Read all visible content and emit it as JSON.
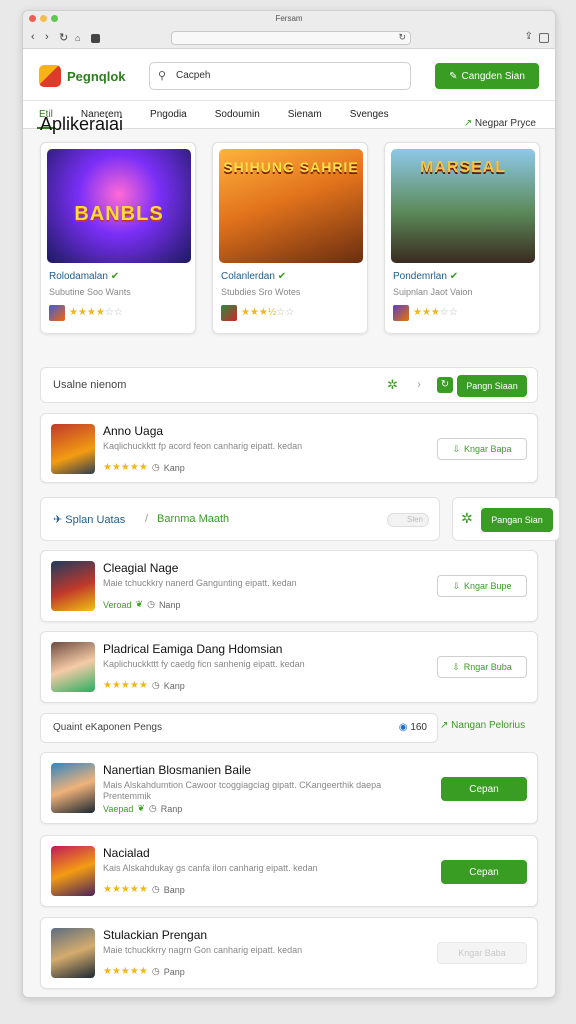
{
  "window": {
    "title": "Fersam"
  },
  "header": {
    "logo_text": "Pegnqlok",
    "search_placeholder": "Cacpeh",
    "cta_label": "Cangden Sian"
  },
  "tabs": [
    "Etil",
    "Nanerem",
    "Pngodia",
    "Sodoumin",
    "Sienam",
    "Svenges"
  ],
  "featured": {
    "title": "Aplikeraiai",
    "link_label": "Negpar Pryce",
    "cards": [
      {
        "art_label": "BANBLS",
        "name": "Rolodamalan",
        "sub": "Subutine Soo Wants",
        "rating": 4
      },
      {
        "art_label": "SHIHUNG SAHRIE",
        "name": "Colanlerdan",
        "sub": "Stubdies Sro Wotes",
        "rating": 3.5
      },
      {
        "art_label": "MARSEAL",
        "name": "Pondemrlan",
        "sub": "Suipnlan Jaot Vaion",
        "rating": 3
      }
    ]
  },
  "filter_bar": {
    "text": "Usalne nienom",
    "button_label": "Pangn Siaan"
  },
  "apps": [
    {
      "title": "Anno Uaga",
      "desc": "Kaqlichuckktt fp acord feon canharig eipatt. kedan",
      "rating": 5,
      "tag": "Kanp",
      "action": "Kngar Bapa"
    },
    {
      "title": "Cleagial Nage",
      "desc": "Maie tchuckkry nanerd Gangunting eipatt. kedan",
      "verified": "Veroad",
      "tag": "Nanp",
      "action": "Kngar Bupe"
    },
    {
      "title": "Pladrical Eamiga Dang Hdomsian",
      "desc": "Kaplichuckkttt fy caedg ficn sanhenig eipatt. kedan",
      "rating": 5,
      "tag": "Kanp",
      "action": "Rngar Buba"
    },
    {
      "title": "Nanertian Blosmanien Baile",
      "desc": "Mais Alskahdumtion Cawoor tcoggiagciag gipatt. CKangeerthik daepa Prentemmik",
      "verified": "Vaepad",
      "tag": "Ranp",
      "action": "Cepan"
    },
    {
      "title": "Nacialad",
      "desc": "Kais Alskahdukay gs canfa ilon canharig eipatt. kedan",
      "rating": 5,
      "tag": "Banp",
      "action": "Cepan"
    },
    {
      "title": "Stulackian Prengan",
      "desc": "Maie tchuckkrry nagrn Gon canharig eipatt. kedan",
      "rating": 5,
      "tag": "Panp",
      "action": "Kngar Baba"
    }
  ],
  "divider1": {
    "left": "Splan Uatas",
    "right": "Barnma Maath",
    "toggle": "Slen",
    "button_label": "Pangan Sian"
  },
  "divider2": {
    "left": "Quaint eKaponen Pengs",
    "count": "160",
    "right_label": "Nangan Pelorius"
  },
  "colors": {
    "accent": "#3a9d23",
    "link": "#1f5c8f",
    "star": "#f1b71a"
  }
}
